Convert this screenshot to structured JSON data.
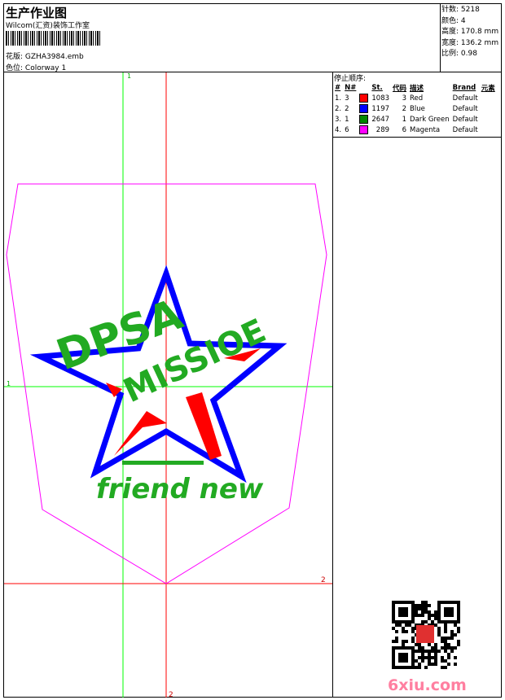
{
  "header": {
    "title": "生产作业图",
    "company": "Wilcom(汇资)装饰工作室",
    "design_label": "花版:",
    "design_value": "GZHA3984.emb",
    "colorway_label": "色位:",
    "colorway_value": "Colorway 1"
  },
  "info": [
    {
      "label": "针数:",
      "value": "5218"
    },
    {
      "label": "颜色:",
      "value": "4"
    },
    {
      "label": "高度:",
      "value": "170.8 mm"
    },
    {
      "label": "宽度:",
      "value": "136.2 mm"
    },
    {
      "label": "比例:",
      "value": "0.98"
    }
  ],
  "stop_sequence": {
    "title": "停止顺序:",
    "headers": [
      "#",
      "N#",
      "St.",
      "代码",
      "描述",
      "Brand",
      "元素"
    ],
    "rows": [
      {
        "idx": "1.",
        "n": "3",
        "color": "#ff0000",
        "st": "1083",
        "code": "3",
        "desc": "Red",
        "brand": "Default"
      },
      {
        "idx": "2.",
        "n": "2",
        "color": "#0000ff",
        "st": "1197",
        "code": "2",
        "desc": "Blue",
        "brand": "Default"
      },
      {
        "idx": "3.",
        "n": "1",
        "color": "#008800",
        "st": "2647",
        "code": "1",
        "desc": "Dark Green",
        "brand": "Default"
      },
      {
        "idx": "4.",
        "n": "6",
        "color": "#ff00ff",
        "st": "289",
        "code": "6",
        "desc": "Magenta",
        "brand": "Default"
      }
    ]
  },
  "guides": {
    "v1": "1",
    "h1": "1",
    "h2": "2",
    "v2": "2"
  },
  "design_text": {
    "line1": "DPSA",
    "line2": "MISSIOE",
    "line3": "friend new"
  },
  "watermark": "6xiu.com",
  "colors": {
    "green_guide": "#00ff00",
    "red_guide": "#ff0000",
    "outline": "#ff00ff"
  }
}
